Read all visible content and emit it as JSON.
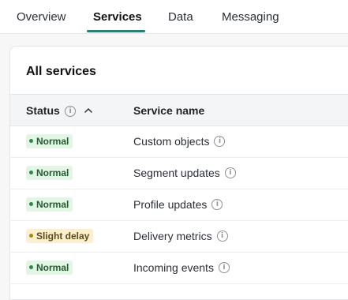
{
  "tabs": [
    {
      "label": "Overview",
      "active": false
    },
    {
      "label": "Services",
      "active": true
    },
    {
      "label": "Data",
      "active": false
    },
    {
      "label": "Messaging",
      "active": false
    }
  ],
  "card": {
    "title": "All services"
  },
  "table": {
    "headers": {
      "status": "Status",
      "service_name": "Service name"
    },
    "sort": "ascending",
    "rows": [
      {
        "status": "Normal",
        "status_type": "normal",
        "service": "Custom objects"
      },
      {
        "status": "Normal",
        "status_type": "normal",
        "service": "Segment updates"
      },
      {
        "status": "Normal",
        "status_type": "normal",
        "service": "Profile updates"
      },
      {
        "status": "Slight delay",
        "status_type": "delay",
        "service": "Delivery metrics"
      },
      {
        "status": "Normal",
        "status_type": "normal",
        "service": "Incoming events"
      }
    ]
  },
  "icons": {
    "info": "info-icon",
    "sort": "chevron-up-icon"
  },
  "colors": {
    "accent": "#2a7e6f",
    "normal_bg": "#e3f5e5",
    "normal_text": "#1f5e2c",
    "delay_bg": "#fcefcf",
    "delay_text": "#5e4a12"
  }
}
